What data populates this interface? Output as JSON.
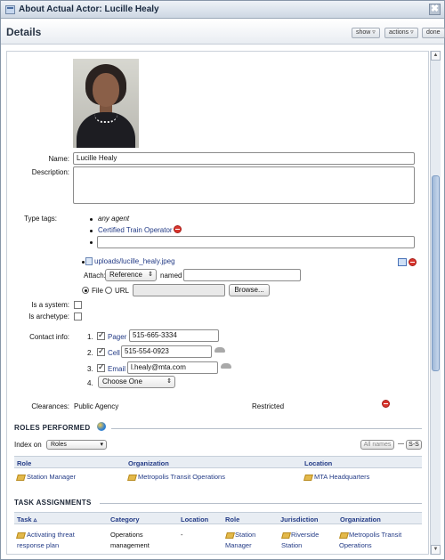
{
  "window": {
    "title": "About Actual Actor: Lucille Healy",
    "close_glyph": "✖"
  },
  "header": {
    "title": "Details",
    "show_label": "show ▿",
    "actions_label": "actions ▿",
    "done_label": "done"
  },
  "details": {
    "name_label": "Name:",
    "name_value": "Lucille Healy",
    "description_label": "Description:",
    "description_value": "",
    "type_tags_label": "Type tags:",
    "tag_any": "any agent",
    "tag_certified": "Certified Train Operator",
    "tag_input_value": "",
    "upload_link": "uploads/lucille_healy.jpeg",
    "attach_label": "Attach:",
    "attach_select": "Reference",
    "named_label": "named",
    "named_value": "",
    "file_label": "File",
    "url_label": "URL",
    "browse_label": "Browse...",
    "is_system_label": "Is a system:",
    "is_archetype_label": "Is archetype:",
    "contact_label": "Contact info:",
    "contacts": [
      {
        "num": "1.",
        "type": "Pager",
        "value": "515-665-3334"
      },
      {
        "num": "2.",
        "type": "Cell",
        "value": "515-554-0923"
      },
      {
        "num": "3.",
        "type": "Email",
        "value": "l.healy@mta.com"
      },
      {
        "num": "4.",
        "choose": "Choose One"
      }
    ],
    "clearances_label": "Clearances:",
    "clearance_value": "Public Agency",
    "clearance_level": "Restricted"
  },
  "roles": {
    "title": "ROLES PERFORMED",
    "index_label": "Index on",
    "index_value": "Roles",
    "all_names": "All names",
    "dash": "—",
    "ss": "S-S",
    "headers": [
      "Role",
      "Organization",
      "Location"
    ],
    "rows": [
      [
        "Station Manager",
        "Metropolis Transit Operations",
        "MTA Headquarters"
      ]
    ]
  },
  "tasks": {
    "title": "TASK ASSIGNMENTS",
    "headers": [
      "Task ▵",
      "Category",
      "Location",
      "Role",
      "Jurisdiction",
      "Organization"
    ],
    "row": {
      "task_1": "Activating threat",
      "task_2": "response plan",
      "cat_1": "Operations",
      "cat_2": "management",
      "location": "-",
      "role_1": "Station",
      "role_2": "Manager",
      "jur_1": "Riverside",
      "jur_2": "Station",
      "org_1": "Metropolis Transit",
      "org_2": "Operations"
    }
  },
  "icons": [
    "window-icon",
    "close-icon",
    "photo",
    "delete-icon",
    "file-icon",
    "checkbox",
    "radio",
    "cloud-icon",
    "tag-icon",
    "globe-icon",
    "scrollbar"
  ]
}
